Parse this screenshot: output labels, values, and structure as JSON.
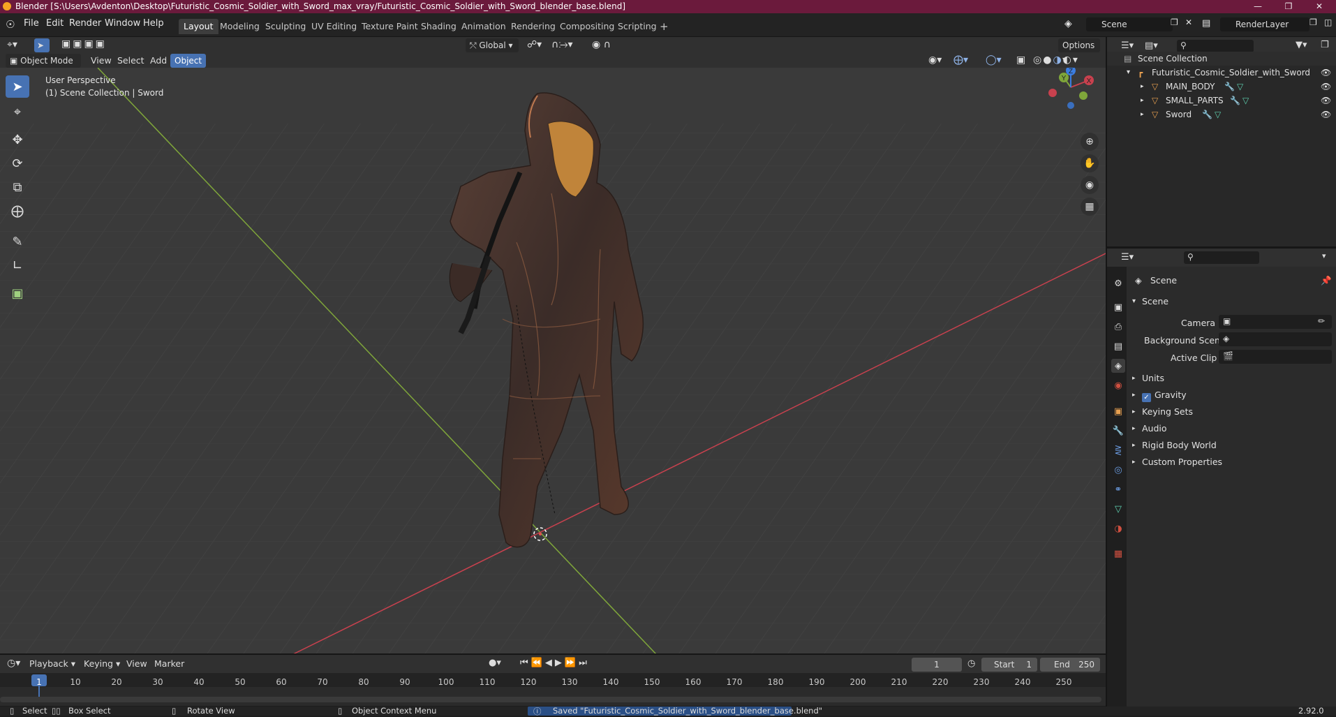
{
  "titlebar": {
    "title": "Blender [S:\\Users\\Avdenton\\Desktop\\Futuristic_Cosmic_Soldier_with_Sword_max_vray/Futuristic_Cosmic_Soldier_with_Sword_blender_base.blend]"
  },
  "menu": [
    "File",
    "Edit",
    "Render",
    "Window",
    "Help"
  ],
  "workspaces": [
    "Layout",
    "Modeling",
    "Sculpting",
    "UV Editing",
    "Texture Paint",
    "Shading",
    "Animation",
    "Rendering",
    "Compositing",
    "Scripting"
  ],
  "active_workspace": "Layout",
  "scene_name": "Scene",
  "view_layer": "RenderLayer",
  "viewport": {
    "transform_orientation": "Global",
    "options_label": "Options",
    "mode": "Object Mode",
    "menus": [
      "View",
      "Select",
      "Add",
      "Object"
    ],
    "perspective_label": "User Perspective",
    "collection_label": "(1) Scene Collection | Sword",
    "gizmo_axes": [
      "X",
      "Y",
      "Z"
    ]
  },
  "outliner": {
    "root": "Scene Collection",
    "collection": "Futuristic_Cosmic_Soldier_with_Sword",
    "objects": [
      "MAIN_BODY",
      "SMALL_PARTS",
      "Sword"
    ]
  },
  "properties": {
    "context_title": "Scene",
    "section_title": "Scene",
    "fields": {
      "camera_label": "Camera",
      "background_scene_label": "Background Scene",
      "active_clip_label": "Active Clip"
    },
    "panels": [
      "Units",
      "Gravity",
      "Keying Sets",
      "Audio",
      "Rigid Body World",
      "Custom Properties"
    ],
    "gravity_enabled": true
  },
  "timeline": {
    "menus": [
      "Playback",
      "Keying",
      "View",
      "Marker"
    ],
    "current_frame": "1",
    "start_label": "Start",
    "start_value": "1",
    "end_label": "End",
    "end_value": "250",
    "ruler": [
      "1",
      "10",
      "20",
      "30",
      "40",
      "50",
      "60",
      "70",
      "80",
      "90",
      "100",
      "110",
      "120",
      "130",
      "140",
      "150",
      "160",
      "170",
      "180",
      "190",
      "200",
      "210",
      "220",
      "230",
      "240",
      "250"
    ]
  },
  "statusbar": {
    "select": "Select",
    "box_select": "Box Select",
    "rotate_view": "Rotate View",
    "context_menu": "Object Context Menu",
    "message": "Saved \"Futuristic_Cosmic_Soldier_with_Sword_blender_base.blend\"",
    "version": "2.92.0"
  },
  "colors": {
    "title_bar": "#6b1a3c",
    "accent": "#4772b3",
    "x_axis": "#c8414e",
    "y_axis": "#7fa63a",
    "z_axis": "#3b7de0"
  }
}
